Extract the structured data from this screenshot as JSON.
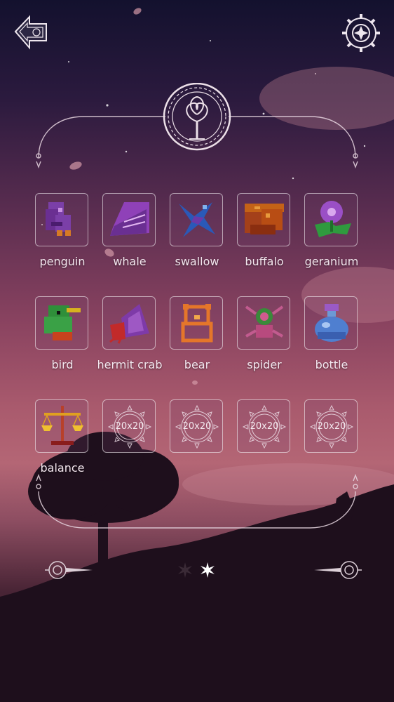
{
  "puzzles": [
    {
      "label": "penguin",
      "locked": false
    },
    {
      "label": "whale",
      "locked": false
    },
    {
      "label": "swallow",
      "locked": false
    },
    {
      "label": "buffalo",
      "locked": false
    },
    {
      "label": "geranium",
      "locked": false
    },
    {
      "label": "bird",
      "locked": false
    },
    {
      "label": "hermit crab",
      "locked": false
    },
    {
      "label": "bear",
      "locked": false
    },
    {
      "label": "spider",
      "locked": false
    },
    {
      "label": "bottle",
      "locked": false
    },
    {
      "label": "balance",
      "locked": false
    },
    {
      "size_text": "20x20",
      "locked": true
    },
    {
      "size_text": "20x20",
      "locked": true
    },
    {
      "size_text": "20x20",
      "locked": true
    },
    {
      "size_text": "20x20",
      "locked": true
    }
  ],
  "pagination": {
    "current_page": 2,
    "total_pages": 2
  },
  "icons": {
    "back": "back-arrow-icon",
    "settings": "gear-icon",
    "tree": "tree-medallion-icon",
    "prev": "ornate-left-arrow-icon",
    "next": "ornate-right-arrow-icon"
  },
  "colors": {
    "sky_top": "#13112e",
    "sky_mid": "#8a4360",
    "hill": "#1c0f1a",
    "frame_line": "#e9d8e2"
  }
}
